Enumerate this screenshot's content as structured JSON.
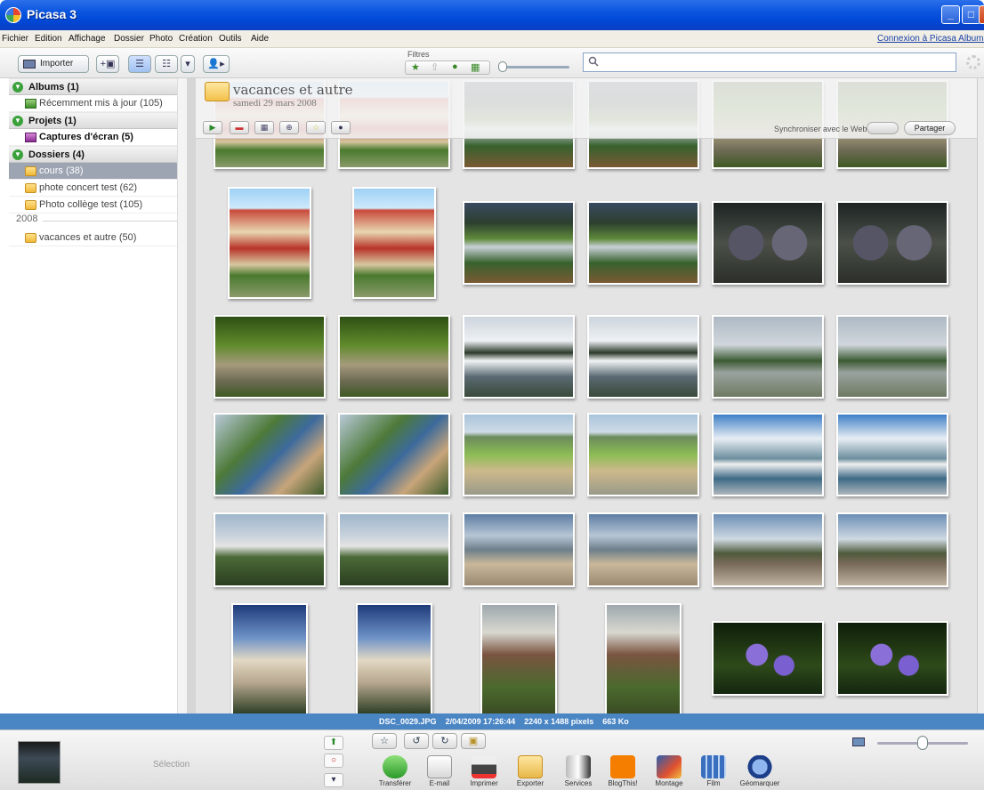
{
  "window": {
    "title": "Picasa 3"
  },
  "menu": {
    "items": [
      "Fichier",
      "Edition",
      "Affichage",
      "Dossier",
      "Photo",
      "Création",
      "Outils",
      "Aide"
    ],
    "web_link": "Connexion à Picasa Albums Web"
  },
  "toolbar": {
    "import_label": "Importer",
    "filters_label": "Filtres"
  },
  "search": {
    "value": "",
    "placeholder": ""
  },
  "sidebar": {
    "sections": [
      {
        "label": "Albums (1)"
      },
      {
        "label": "Projets (1)"
      },
      {
        "label": "Dossiers (4)"
      }
    ],
    "items": [
      {
        "label": "Récemment mis à jour (105)"
      },
      {
        "label": "Captures d'écran (5)"
      },
      {
        "label": "cours (38)"
      },
      {
        "label": "phote concert test (62)"
      },
      {
        "label": "Photo collège test (105)"
      },
      {
        "label": "vacances et autre (50)"
      }
    ],
    "year": "2008"
  },
  "album": {
    "title": "vacances et autre",
    "date": "samedi 29 mars 2008",
    "sync_label": "Synchroniser avec le Web",
    "share_label": "Partager"
  },
  "status": {
    "filename": "DSC_0029.JPG",
    "datetime": "2/04/2009 17:26:44",
    "dimensions": "2240 x 1488 pixels",
    "size": "663 Ko"
  },
  "tray": {
    "selection_label": "Sélection",
    "actions": [
      "Transférer",
      "E-mail",
      "Imprimer",
      "Exporter",
      "Services",
      "BlogThis!",
      "Montage",
      "Film",
      "Géomarquer"
    ]
  },
  "colors": {
    "titlebar": "#0a55e0",
    "statusbar": "#4a85c4",
    "selected_folder": "#9da4b2"
  }
}
